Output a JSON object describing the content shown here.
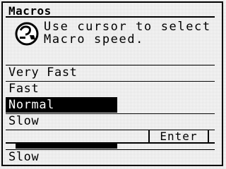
{
  "dialog": {
    "title": "Macros",
    "prompt_line1": "Use cursor to select",
    "prompt_line2": "Macro speed.",
    "icon": "info-icon"
  },
  "menu": {
    "items": [
      {
        "label": "Very Fast",
        "selected": false
      },
      {
        "label": "Fast",
        "selected": false
      },
      {
        "label": "Normal",
        "selected": true
      },
      {
        "label": "Slow",
        "selected": false
      }
    ]
  },
  "softkeys": {
    "enter_label": "Enter"
  },
  "background_list": {
    "item_label": "Slow"
  },
  "colors": {
    "foreground": "#000000",
    "background": "#ffffff",
    "selected_bg": "#000000",
    "selected_fg": "#ffffff"
  }
}
